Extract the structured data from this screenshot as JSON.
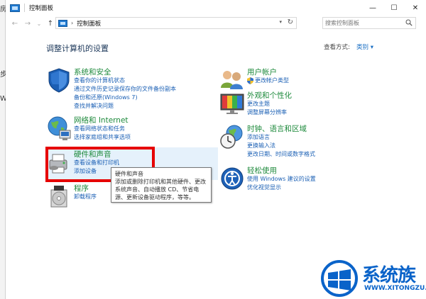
{
  "window": {
    "title": "控制面板",
    "minimize": "—",
    "maximize": "☐",
    "close": "✕"
  },
  "nav": {
    "back": "←",
    "forward": "→",
    "recent": "⌄",
    "up": "↑",
    "breadcrumb": "控制面板",
    "search_placeholder": "搜索控制面板"
  },
  "main": {
    "heading": "调整计算机的设置",
    "view_by_label": "查看方式:",
    "view_by_value": "类别 ▾"
  },
  "categories": [
    {
      "title": "系统和安全",
      "links": [
        "查看你的计算机状态",
        "通过文件历史记录保存你的文件备份副本",
        "备份和还原(Windows 7)",
        "查找并解决问题"
      ]
    },
    {
      "title": "网络和 Internet",
      "links": [
        "查看网络状态和任务",
        "选择家庭组和共享选项"
      ]
    },
    {
      "title": "硬件和声音",
      "links": [
        "查看设备和打印机",
        "添加设备"
      ]
    },
    {
      "title": "程序",
      "links": [
        "卸载程序"
      ]
    },
    {
      "title": "用户帐户",
      "links": [
        "更改帐户类型"
      ]
    },
    {
      "title": "外观和个性化",
      "links": [
        "更改主题",
        "调整屏幕分辨率"
      ]
    },
    {
      "title": "时钟、语言和区域",
      "links": [
        "添加语言",
        "更换输入法",
        "更改日期、时间或数字格式"
      ]
    },
    {
      "title": "轻松使用",
      "links": [
        "使用 Windows 建议的设置",
        "优化视觉显示"
      ]
    }
  ],
  "tooltip": {
    "line1": "硬件和声音",
    "line2": "添加或删除打印机和其他硬件、更改",
    "line3": "系统声音、自动播放 CD、节省电",
    "line4": "源、更新设备驱动程序，等等。"
  },
  "watermark": {
    "brand": "系统族",
    "url": "WWW.XITONGZU.COM"
  },
  "colors": {
    "link": "#1a5fb4",
    "category_title": "#1e8a3c",
    "highlight": "#e5f1fb",
    "annotation_box": "#e60000",
    "brand": "#0a63c9"
  }
}
